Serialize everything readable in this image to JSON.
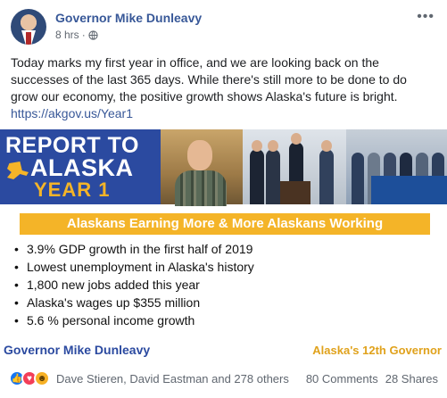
{
  "post": {
    "author": "Governor Mike Dunleavy",
    "time": "8 hrs",
    "dot": "·",
    "text": "Today marks my first year in office, and we are looking back on the successes of the last 365 days. While there's still more to be done to do grow our economy, the positive growth shows Alaska's future is bright.",
    "link": "https://akgov.us/Year1"
  },
  "graphic": {
    "report_line1": "REPORT TO",
    "report_line2": "ALASKA",
    "report_line3": "YEAR 1",
    "headline": "Alaskans Earning More & More Alaskans Working",
    "bullets": [
      "3.9% GDP growth in the first half of 2019",
      "Lowest unemployment in Alaska's history",
      "1,800 new jobs added this year",
      "Alaska's wages up $355 million",
      "5.6 % personal income growth"
    ],
    "footer_left": "Governor Mike Dunleavy",
    "footer_right": "Alaska's 12th Governor",
    "colors": {
      "banner_blue": "#2b4aa0",
      "accent_gold": "#f4b428",
      "link_blue": "#385898"
    }
  },
  "engagement": {
    "reaction_icons": [
      "like-icon",
      "love-icon",
      "haha-icon"
    ],
    "reactors": "Dave Stieren, David Eastman and 278 others",
    "comments": "80 Comments",
    "shares": "28 Shares"
  }
}
